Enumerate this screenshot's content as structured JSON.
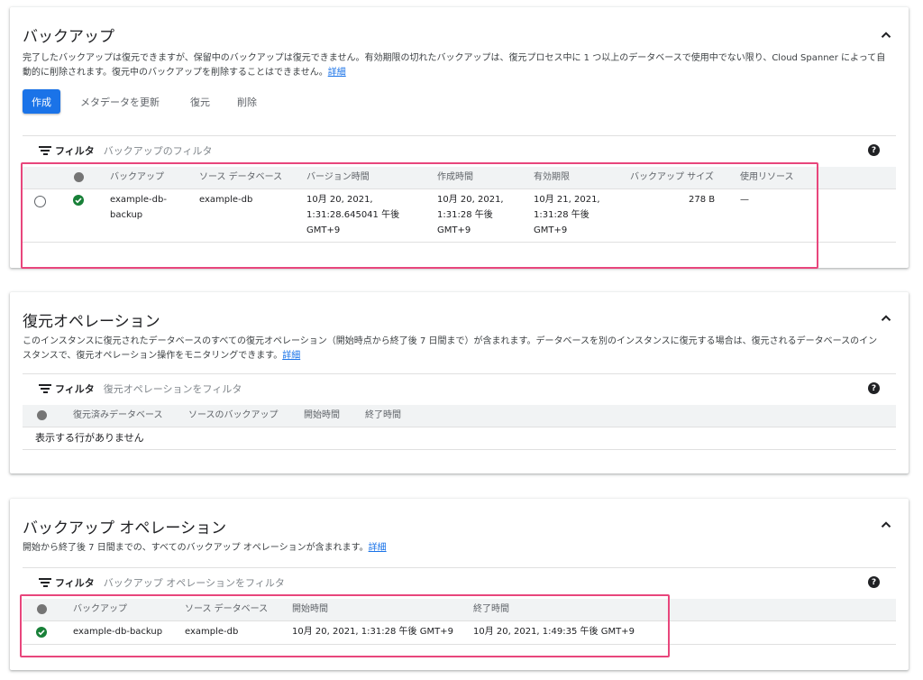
{
  "backups": {
    "title": "バックアップ",
    "description_line1": "完了したバックアップは復元できますが、保留中のバックアップは復元できません。有効期限の切れたバックアップは、復元プロセス中に 1 つ以上のデータベースで使用中でない限り、Cloud Spanner によって自",
    "description_line2": "動的に削除されます。復元中のバックアップを削除することはできません。",
    "details_link": "詳細",
    "actions": {
      "create": "作成",
      "update_metadata": "メタデータを更新",
      "restore": "復元",
      "delete": "削除"
    },
    "filter": {
      "label": "フィルタ",
      "placeholder": "バックアップのフィルタ"
    },
    "columns": {
      "backup": "バックアップ",
      "source_db": "ソース データベース",
      "version_time": "バージョン時間",
      "create_time": "作成時間",
      "expire_time": "有効期限",
      "backup_size": "バックアップ サイズ",
      "in_use_by": "使用リソース"
    },
    "row": {
      "backup_l1": "example-db-",
      "backup_l2": "backup",
      "source_db": "example-db",
      "version_l1": "10月 20, 2021,",
      "version_l2": "1:31:28.645041 午後",
      "version_l3": "GMT+9",
      "create_l1": "10月 20, 2021,",
      "create_l2": "1:31:28 午後",
      "create_l3": "GMT+9",
      "expire_l1": "10月 21, 2021,",
      "expire_l2": "1:31:28 午後",
      "expire_l3": "GMT+9",
      "size": "278 B",
      "in_use_by": "—"
    }
  },
  "restore_ops": {
    "title": "復元オペレーション",
    "description_line1": "このインスタンスに復元されたデータベースのすべての復元オペレーション（開始時点から終了後 7 日間まで）が含まれます。データベースを別のインスタンスに復元する場合は、復元されるデータベースのイン",
    "description_line2": "スタンスで、復元オペレーション操作をモニタリングできます。",
    "details_link": "詳細",
    "filter": {
      "label": "フィルタ",
      "placeholder": "復元オペレーションをフィルタ"
    },
    "columns": {
      "restored_db": "復元済みデータベース",
      "source_backup": "ソースのバックアップ",
      "start_time": "開始時間",
      "end_time": "終了時間"
    },
    "empty_text": "表示する行がありません"
  },
  "backup_ops": {
    "title": "バックアップ オペレーション",
    "description": "開始から終了後 7 日間までの、すべてのバックアップ オペレーションが含まれます。",
    "details_link": "詳細",
    "filter": {
      "label": "フィルタ",
      "placeholder": "バックアップ オペレーションをフィルタ"
    },
    "columns": {
      "backup": "バックアップ",
      "source_db": "ソース データベース",
      "start_time": "開始時間",
      "end_time": "終了時間"
    },
    "row": {
      "backup": "example-db-backup",
      "source_db": "example-db",
      "start_time": "10月 20, 2021, 1:31:28 午後 GMT+9",
      "end_time": "10月 20, 2021, 1:49:35 午後 GMT+9"
    }
  },
  "icons": {
    "help_glyph": "?",
    "status_ok_color": "#188038",
    "highlight_color": "#e8467c",
    "primary_color": "#1a73e8"
  }
}
